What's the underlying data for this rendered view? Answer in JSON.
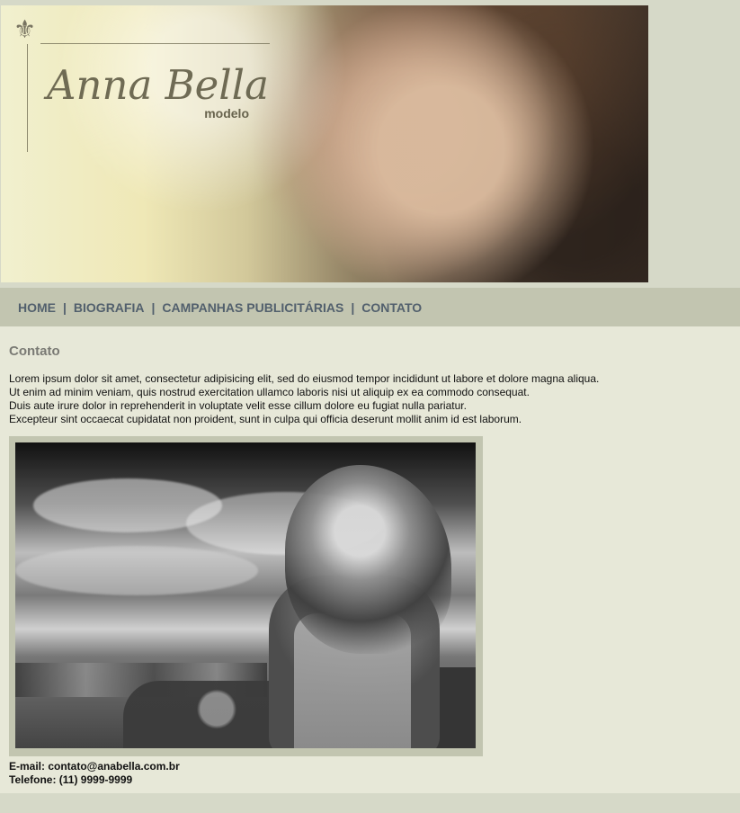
{
  "header": {
    "brand_name": "Anna Bella",
    "brand_subtitle": "modelo"
  },
  "nav": {
    "items": [
      {
        "label": "HOME"
      },
      {
        "label": "BIOGRAFIA"
      },
      {
        "label": "CAMPANHAS PUBLICITÁRIAS"
      },
      {
        "label": "CONTATO"
      }
    ],
    "separator": "|"
  },
  "main": {
    "title": "Contato",
    "paragraph_lines": [
      "Lorem ipsum dolor sit amet, consectetur adipisicing elit, sed do eiusmod tempor incididunt ut labore et dolore magna aliqua.",
      "Ut enim ad minim veniam, quis nostrud exercitation ullamco laboris nisi ut aliquip ex ea commodo consequat.",
      "Duis aute irure dolor in reprehenderit in voluptate velit esse cillum dolore eu fugiat nulla pariatur.",
      "Excepteur sint occaecat cupidatat non proident, sunt in culpa qui officia deserunt mollit anim id est laborum."
    ],
    "contact": {
      "email": "E-mail: contato@anabella.com.br",
      "phone": "Telefone: (11) 9999-9999"
    }
  },
  "colors": {
    "page_bg": "#d6d9c8",
    "nav_bg": "#c2c5b0",
    "content_bg": "#e7e8d8",
    "nav_text": "#52606d",
    "title_text": "#7a7a74",
    "body_text": "#111111"
  }
}
